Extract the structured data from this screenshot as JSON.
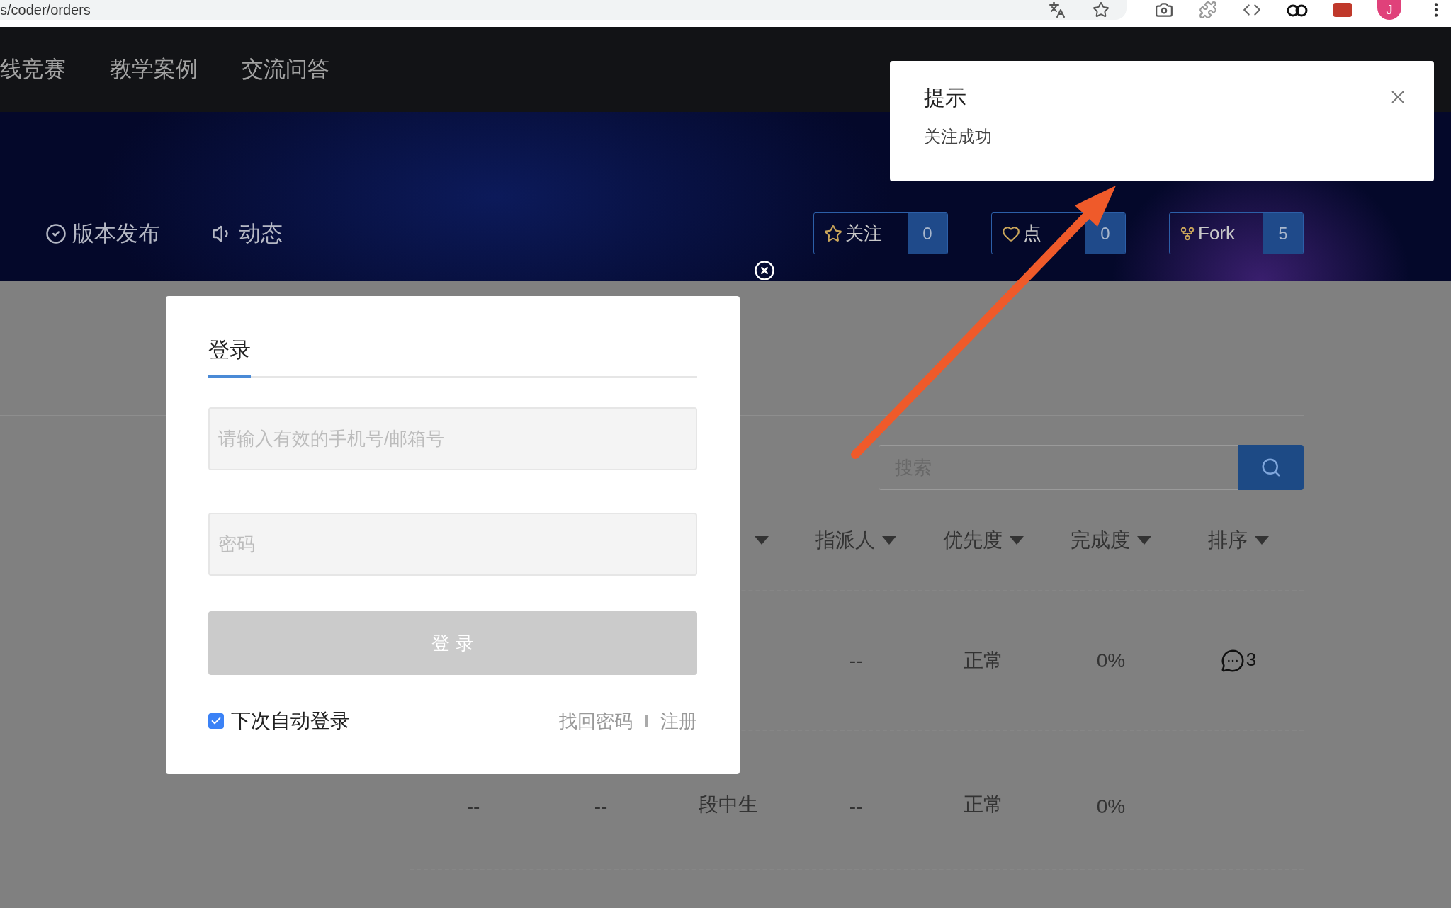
{
  "browser": {
    "url": "s/coder/orders",
    "avatar": "J"
  },
  "nav": {
    "items": [
      "线竞赛",
      "教学案例",
      "交流问答"
    ]
  },
  "banner": {
    "links": [
      {
        "kind": "release",
        "label": "版本发布"
      },
      {
        "kind": "activity",
        "label": "动态"
      }
    ],
    "actions": [
      {
        "kind": "watch",
        "label": "关注",
        "count": "0"
      },
      {
        "kind": "like",
        "label": "点",
        "count": "0"
      },
      {
        "kind": "fork",
        "label": "Fork",
        "count": "5"
      }
    ]
  },
  "search": {
    "placeholder": "搜索"
  },
  "table": {
    "columns": [
      {
        "kind": "covered"
      },
      {
        "kind": "covered"
      },
      {
        "kind": "sort"
      },
      {
        "kind": "sort",
        "label": "指派人"
      },
      {
        "kind": "sort",
        "label": "优先度"
      },
      {
        "kind": "sort",
        "label": "完成度"
      },
      {
        "kind": "sort",
        "label": "排序"
      }
    ],
    "rows": [
      {
        "cells": [
          {
            "kind": "covered"
          },
          {
            "kind": "covered"
          },
          {
            "kind": "covered"
          },
          {
            "kind": "text",
            "text": "--"
          },
          {
            "kind": "text",
            "text": "正常"
          },
          {
            "kind": "text",
            "text": "0%"
          },
          {
            "kind": "comments",
            "count": "3"
          }
        ]
      },
      {
        "cells": [
          {
            "kind": "text",
            "text": "--"
          },
          {
            "kind": "text",
            "text": "--"
          },
          {
            "kind": "text",
            "text": "段中生"
          },
          {
            "kind": "text",
            "text": "--"
          },
          {
            "kind": "text",
            "text": "正常"
          },
          {
            "kind": "text",
            "text": "0%"
          },
          {
            "kind": "covered"
          }
        ]
      }
    ]
  },
  "login_dialog": {
    "tabs": [
      {
        "label": "登录",
        "selected": true
      }
    ],
    "phone": {
      "placeholder": "请输入有效的手机号/邮箱号"
    },
    "password": {
      "placeholder": "密码"
    },
    "submit": {
      "label": "登 录",
      "disabled": true
    },
    "remember": {
      "label": "下次自动登录",
      "checked": true
    },
    "links": [
      "找回密码",
      "注册"
    ]
  },
  "toast": {
    "title": "提示",
    "message": "关注成功"
  }
}
